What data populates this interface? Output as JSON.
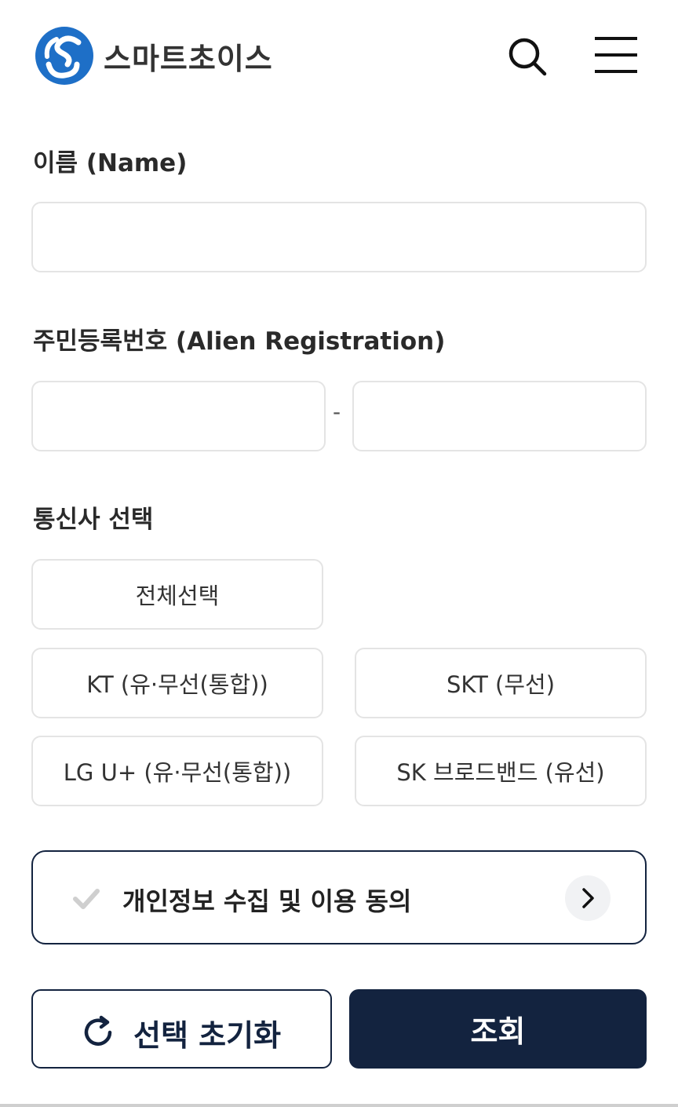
{
  "header": {
    "brand_name": "스마트초이스",
    "search_icon": "search-icon",
    "menu_icon": "hamburger-menu-icon"
  },
  "form": {
    "name_label": "이름 (Name)",
    "name_value": "",
    "id_label": "주민등록번호 (Alien Registration)",
    "id_front_value": "",
    "id_separator": "-",
    "id_back_value": "",
    "carrier_label": "통신사 선택",
    "carriers": {
      "select_all": "전체선택",
      "kt": "KT (유·무선(통합))",
      "skt": "SKT (무선)",
      "lgu": "LG U+ (유·무선(통합))",
      "skb": "SK 브로드밴드 (유선)"
    }
  },
  "agreement": {
    "text": "개인정보 수집 및 이용 동의",
    "check_icon": "check-icon",
    "arrow_icon": "chevron-right-icon"
  },
  "actions": {
    "reset_label": "선택 초기화",
    "reset_icon": "refresh-icon",
    "submit_label": "조회"
  },
  "colors": {
    "primary": "#13233f",
    "logo_blue": "#1e6fc7",
    "border": "#e4e4e4",
    "check_gray": "#cfcfcf"
  }
}
